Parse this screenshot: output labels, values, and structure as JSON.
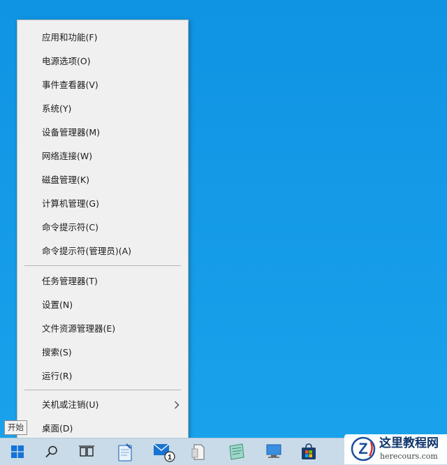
{
  "context_menu": {
    "items": [
      {
        "label": "应用和功能(F)"
      },
      {
        "label": "电源选项(O)"
      },
      {
        "label": "事件查看器(V)"
      },
      {
        "label": "系统(Y)"
      },
      {
        "label": "设备管理器(M)"
      },
      {
        "label": "网络连接(W)"
      },
      {
        "label": "磁盘管理(K)"
      },
      {
        "label": "计算机管理(G)"
      },
      {
        "label": "命令提示符(C)"
      },
      {
        "label": "命令提示符(管理员)(A)"
      },
      {
        "label": "任务管理器(T)"
      },
      {
        "label": "设置(N)"
      },
      {
        "label": "文件资源管理器(E)"
      },
      {
        "label": "搜索(S)"
      },
      {
        "label": "运行(R)"
      },
      {
        "label": "关机或注销(U)",
        "has_submenu": true
      },
      {
        "label": "桌面(D)"
      }
    ]
  },
  "start_tooltip": "开始",
  "taskbar": {
    "items": [
      {
        "icon": "windows-start-icon"
      },
      {
        "icon": "search-icon"
      },
      {
        "icon": "task-view-icon"
      },
      {
        "icon": "notepad-app-icon"
      },
      {
        "icon": "mail-icon",
        "badge": "1"
      },
      {
        "icon": "document-app-icon"
      },
      {
        "icon": "notes-app-icon"
      },
      {
        "icon": "monitor-icon"
      },
      {
        "icon": "store-icon"
      }
    ]
  },
  "watermark": {
    "title": "这里教程网",
    "url": "herecours.com",
    "logo_letter": "Z"
  },
  "colors": {
    "desktop": "#1296e4",
    "menu_bg": "#f0f0f0",
    "taskbar_bg": "#c9dbe8",
    "watermark_title": "#10366b",
    "watermark_logo": "#1a4f9c"
  }
}
